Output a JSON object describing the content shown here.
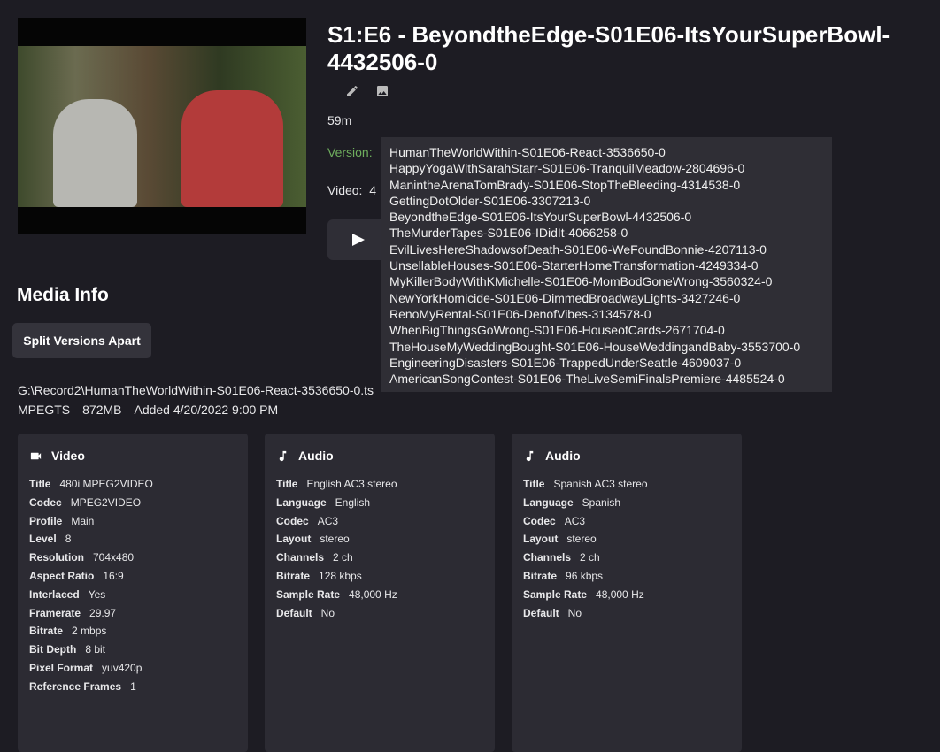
{
  "title": "S1:E6 - BeyondtheEdge-S01E06-ItsYourSuperBowl-4432506-0",
  "runtime": "59m",
  "version_label": "Version:",
  "video_label": "Video:",
  "video_value_partial": "4",
  "versions": [
    "HumanTheWorldWithin-S01E06-React-3536650-0",
    "HappyYogaWithSarahStarr-S01E06-TranquilMeadow-2804696-0",
    "ManintheArenaTomBrady-S01E06-StopTheBleeding-4314538-0",
    "GettingDotOlder-S01E06-3307213-0",
    "BeyondtheEdge-S01E06-ItsYourSuperBowl-4432506-0",
    "TheMurderTapes-S01E06-IDidIt-4066258-0",
    "EvilLivesHereShadowsofDeath-S01E06-WeFoundBonnie-4207113-0",
    "UnsellableHouses-S01E06-StarterHomeTransformation-4249334-0",
    "MyKillerBodyWithKMichelle-S01E06-MomBodGoneWrong-3560324-0",
    "NewYorkHomicide-S01E06-DimmedBroadwayLights-3427246-0",
    "RenoMyRental-S01E06-DenofVibes-3134578-0",
    "WhenBigThingsGoWrong-S01E06-HouseofCards-2671704-0",
    "TheHouseMyWeddingBought-S01E06-HouseWeddingandBaby-3553700-0",
    "EngineeringDisasters-S01E06-TrappedUnderSeattle-4609037-0",
    "AmericanSongContest-S01E06-TheLiveSemiFinalsPremiere-4485524-0"
  ],
  "media_info_heading": "Media Info",
  "split_button": "Split Versions Apart",
  "file_path": "G:\\Record2\\HumanTheWorldWithin-S01E06-React-3536650-0.ts",
  "container": "MPEGTS",
  "size": "872MB",
  "added": "Added 4/20/2022 9:00 PM",
  "streams": [
    {
      "type": "Video",
      "icon": "video-camera-icon",
      "rows": [
        [
          "Title",
          "480i MPEG2VIDEO"
        ],
        [
          "Codec",
          "MPEG2VIDEO"
        ],
        [
          "Profile",
          "Main"
        ],
        [
          "Level",
          "8"
        ],
        [
          "Resolution",
          "704x480"
        ],
        [
          "Aspect Ratio",
          "16:9"
        ],
        [
          "Interlaced",
          "Yes"
        ],
        [
          "Framerate",
          "29.97"
        ],
        [
          "Bitrate",
          "2 mbps"
        ],
        [
          "Bit Depth",
          "8 bit"
        ],
        [
          "Pixel Format",
          "yuv420p"
        ],
        [
          "Reference Frames",
          "1"
        ]
      ]
    },
    {
      "type": "Audio",
      "icon": "music-note-icon",
      "rows": [
        [
          "Title",
          "English AC3 stereo"
        ],
        [
          "Language",
          "English"
        ],
        [
          "Codec",
          "AC3"
        ],
        [
          "Layout",
          "stereo"
        ],
        [
          "Channels",
          "2 ch"
        ],
        [
          "Bitrate",
          "128 kbps"
        ],
        [
          "Sample Rate",
          "48,000 Hz"
        ],
        [
          "Default",
          "No"
        ]
      ]
    },
    {
      "type": "Audio",
      "icon": "music-note-icon",
      "rows": [
        [
          "Title",
          "Spanish AC3 stereo"
        ],
        [
          "Language",
          "Spanish"
        ],
        [
          "Codec",
          "AC3"
        ],
        [
          "Layout",
          "stereo"
        ],
        [
          "Channels",
          "2 ch"
        ],
        [
          "Bitrate",
          "96 kbps"
        ],
        [
          "Sample Rate",
          "48,000 Hz"
        ],
        [
          "Default",
          "No"
        ]
      ]
    }
  ]
}
